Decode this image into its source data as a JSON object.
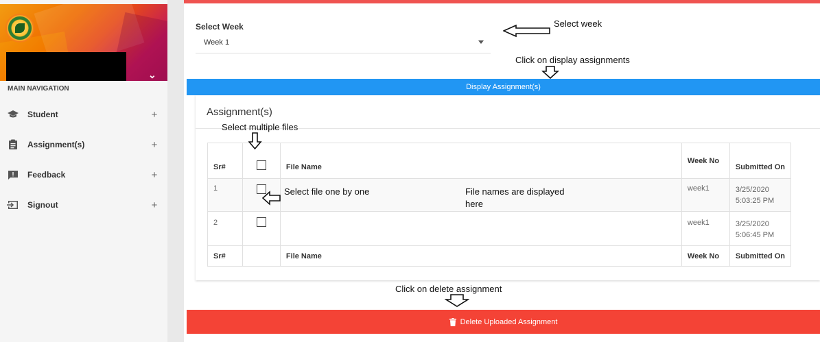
{
  "sidebar": {
    "logo_icon": "college-logo",
    "section_header": "MAIN NAVIGATION",
    "items": [
      {
        "label": "Student",
        "icon": "graduation-cap-icon",
        "expand": "+"
      },
      {
        "label": "Assignment(s)",
        "icon": "clipboard-icon",
        "expand": "+"
      },
      {
        "label": "Feedback",
        "icon": "feedback-icon",
        "expand": "+"
      },
      {
        "label": "Signout",
        "icon": "signout-icon",
        "expand": "+"
      }
    ]
  },
  "main": {
    "select_week_label": "Select Week",
    "select_week_value": "Week 1",
    "display_button": "Display Assignment(s)",
    "card_title": "Assignment(s)",
    "table": {
      "headers": [
        "Sr#",
        "",
        "File Name",
        "Week No",
        "Submitted On"
      ],
      "rows": [
        {
          "sr": "1",
          "file_name": "",
          "week_no": "week1",
          "submitted_on": "3/25/2020 5:03:25 PM"
        },
        {
          "sr": "2",
          "file_name": "",
          "week_no": "week1",
          "submitted_on": "3/25/2020 5:06:45 PM"
        }
      ],
      "footer": [
        "Sr#",
        "",
        "File Name",
        "Week No",
        "Submitted On"
      ]
    },
    "delete_button": "Delete Uploaded Assignment"
  },
  "annotations": {
    "select_week": "Select week",
    "click_display": "Click on display assignments",
    "select_multiple": "Select multiple files",
    "select_one": "Select file one by one",
    "file_names": "File names are displayed",
    "file_names_2": "here",
    "click_delete": "Click on delete assignment"
  },
  "colors": {
    "primary_blue": "#2196f3",
    "danger_red": "#f44336",
    "top_accent": "#ef5350"
  }
}
